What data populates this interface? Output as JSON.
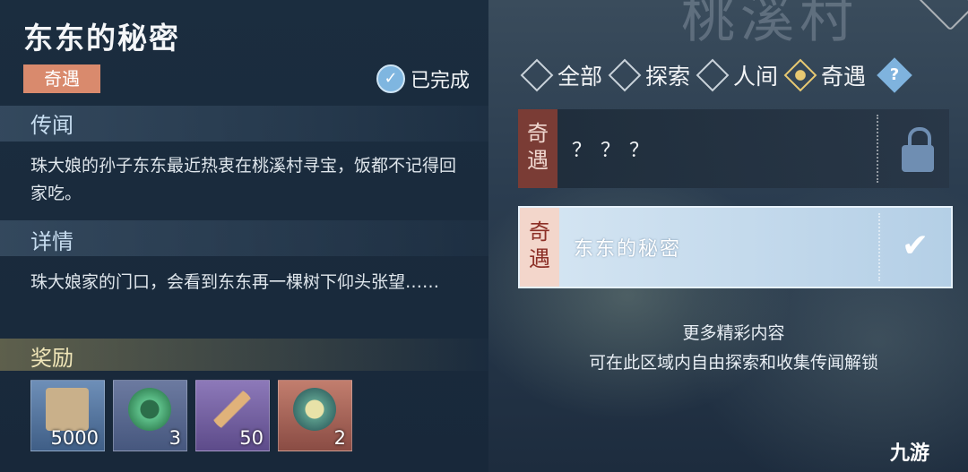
{
  "background": {
    "title": "桃溪村"
  },
  "quest": {
    "title": "东东的秘密",
    "tag": "奇遇",
    "status": "已完成"
  },
  "sections": {
    "rumor": {
      "title": "传闻",
      "text": "珠大娘的孙子东东最近热衷在桃溪村寻宝，饭都不记得回家吃。"
    },
    "detail": {
      "title": "详情",
      "text": "珠大娘家的门口，会看到东东再一棵树下仰头张望……"
    },
    "reward": {
      "title": "奖励"
    }
  },
  "rewards": [
    {
      "icon": "scroll-icon",
      "count": "5000"
    },
    {
      "icon": "jade-icon",
      "count": "3"
    },
    {
      "icon": "dagger-icon",
      "count": "50"
    },
    {
      "icon": "orb-icon",
      "count": "2"
    }
  ],
  "filters": [
    {
      "label": "全部",
      "active": false
    },
    {
      "label": "探索",
      "active": false
    },
    {
      "label": "人间",
      "active": false
    },
    {
      "label": "奇遇",
      "active": true
    }
  ],
  "help_label": "?",
  "cards": [
    {
      "tag": "奇遇",
      "name": "？？？",
      "locked": true
    },
    {
      "tag": "奇遇",
      "name": "东东的秘密",
      "locked": false
    }
  ],
  "more_content": {
    "line1": "更多精彩内容",
    "line2": "可在此区域内自由探索和收集传闻解锁"
  },
  "watermark": "九游",
  "colors": {
    "tag_bg": "#d98a6d",
    "accent_gold": "#e8c972",
    "check_blue": "#7fb6e0"
  }
}
